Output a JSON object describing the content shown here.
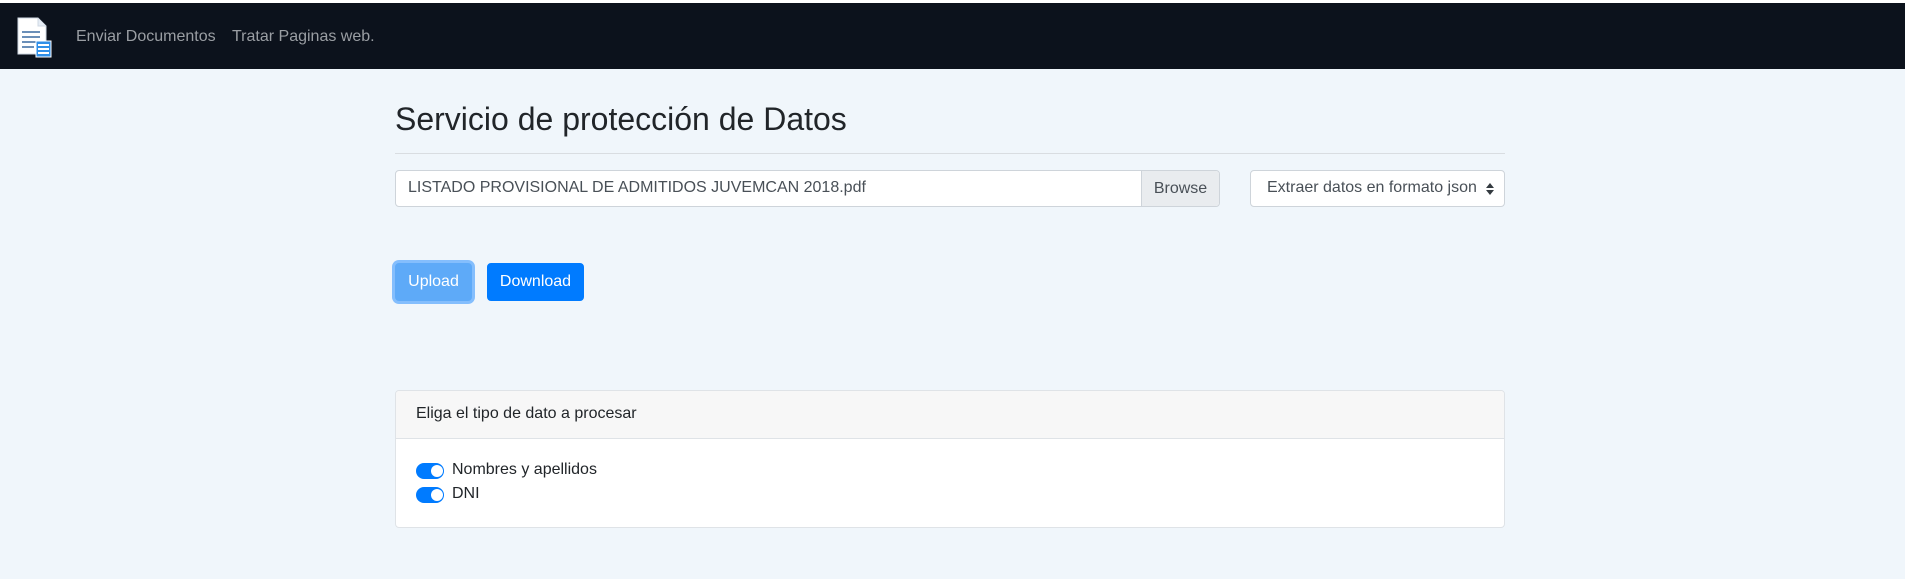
{
  "navbar": {
    "brand_icon": "document-icon",
    "links": [
      {
        "label": "Enviar Documentos"
      },
      {
        "label": "Tratar Paginas web."
      }
    ]
  },
  "main": {
    "title": "Servicio de protección de Datos",
    "file_input": {
      "value": "LISTADO PROVISIONAL DE ADMITIDOS JUVEMCAN 2018.pdf",
      "browse_label": "Browse"
    },
    "format_select": {
      "selected": "Extraer datos en formato json"
    },
    "buttons": {
      "upload_label": "Upload",
      "download_label": "Download"
    },
    "card": {
      "header": "Eliga el tipo de dato a procesar",
      "options": [
        {
          "label": "Nombres y apellidos",
          "checked": true
        },
        {
          "label": "DNI",
          "checked": true
        }
      ]
    }
  },
  "colors": {
    "navbar_bg": "#0c121c",
    "page_bg": "#f0f6fb",
    "primary": "#007bff",
    "upload_active": "#5eaaf8"
  }
}
